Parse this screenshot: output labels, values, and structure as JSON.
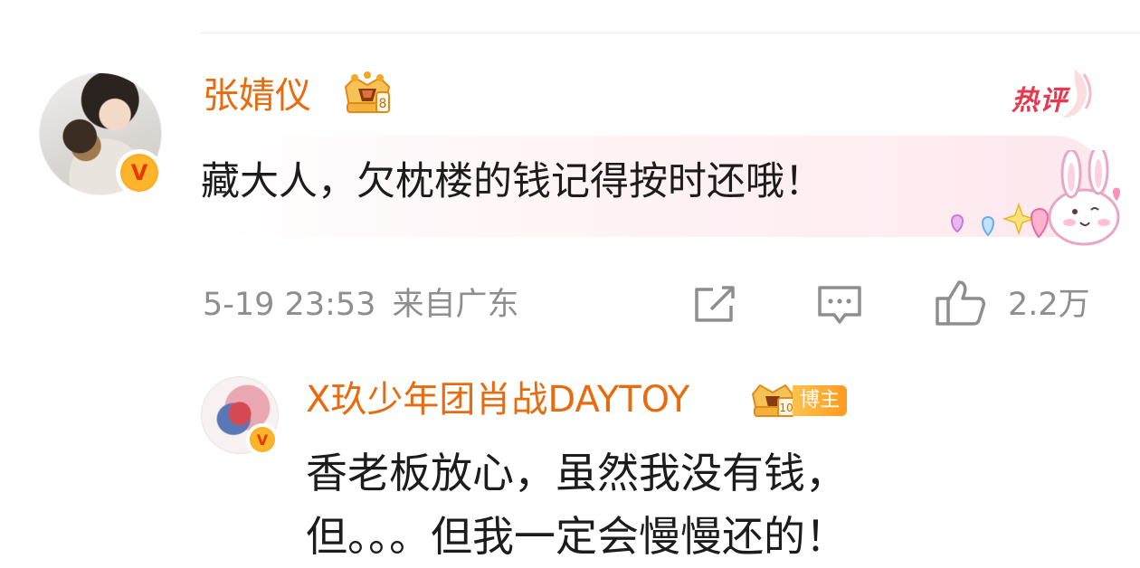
{
  "comment": {
    "username": "张婧仪",
    "hot_label": "热评",
    "text": "藏大人，欠枕楼的钱记得按时还哦！",
    "timestamp": "5-19 23:53",
    "location": "来自广东",
    "like_count": "2.2万",
    "icons": [
      "share-icon",
      "comment-icon",
      "like-icon",
      "crown-badge-icon",
      "verified-v-icon"
    ]
  },
  "reply": {
    "username": "X玖少年团肖战DAYTOY",
    "author_tag": "博主",
    "text_line1": "香老板放心，虽然我没有钱，",
    "text_line2": "但。。。但我一定会慢慢还的！"
  },
  "colors": {
    "username": "#e86b0e",
    "hot": "#e8384d",
    "meta": "#8e8e8e",
    "text": "#1c1c1c",
    "bubble": "#fde8ee"
  },
  "badge_v": "V",
  "crown_level_main": "8",
  "crown_level_reply": "10"
}
